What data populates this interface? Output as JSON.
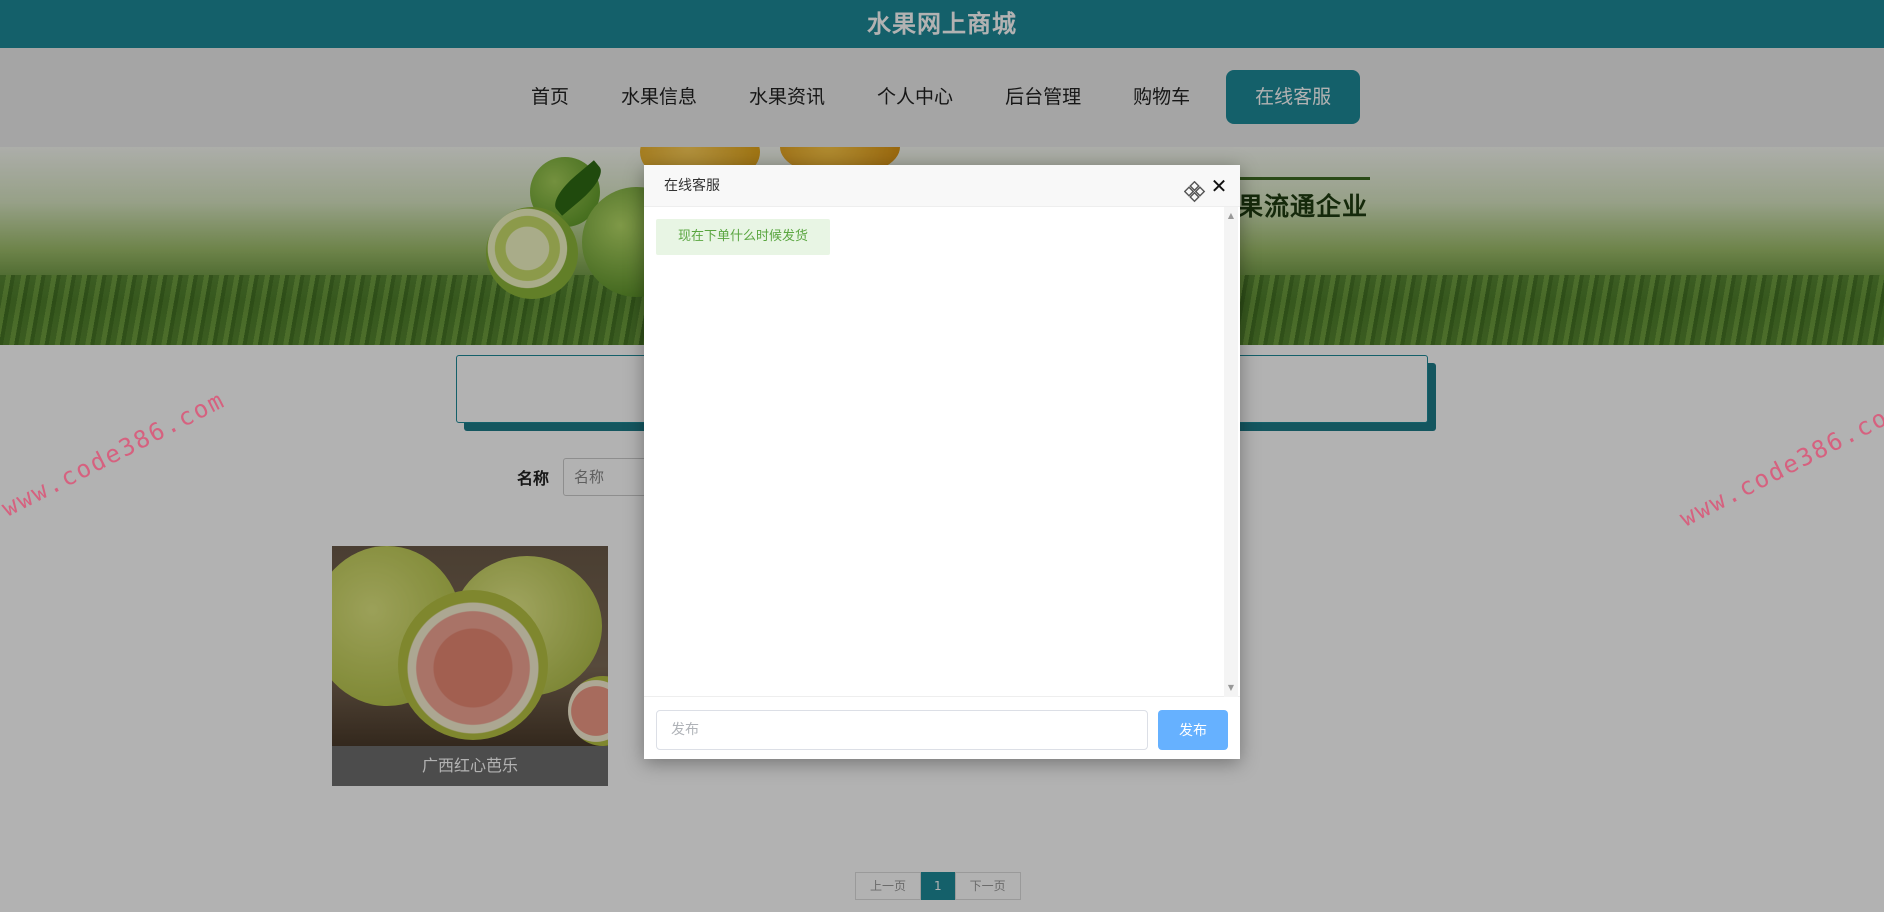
{
  "site": {
    "title": "水果网上商城"
  },
  "nav": {
    "items": [
      {
        "label": "首页"
      },
      {
        "label": "水果信息"
      },
      {
        "label": "水果资讯"
      },
      {
        "label": "个人中心"
      },
      {
        "label": "后台管理"
      },
      {
        "label": "购物车"
      },
      {
        "label": "在线客服"
      }
    ],
    "active_index": 6,
    "accent_color": "#1e8a99"
  },
  "banner": {
    "slogan": "果流通企业"
  },
  "search": {
    "label": "名称",
    "placeholder": "名称"
  },
  "products": [
    {
      "name": "广西红心芭乐"
    }
  ],
  "pagination": {
    "prev": "上一页",
    "current": "1",
    "next": "下一页"
  },
  "watermark": {
    "text": "www.code386.com"
  },
  "chat": {
    "title": "在线客服",
    "messages": [
      {
        "text": "现在下单什么时候发货"
      }
    ],
    "input_placeholder": "发布",
    "send_label": "发布",
    "send_color": "#66b1ff",
    "icons": {
      "move": "move-icon",
      "close": "close-icon"
    }
  }
}
